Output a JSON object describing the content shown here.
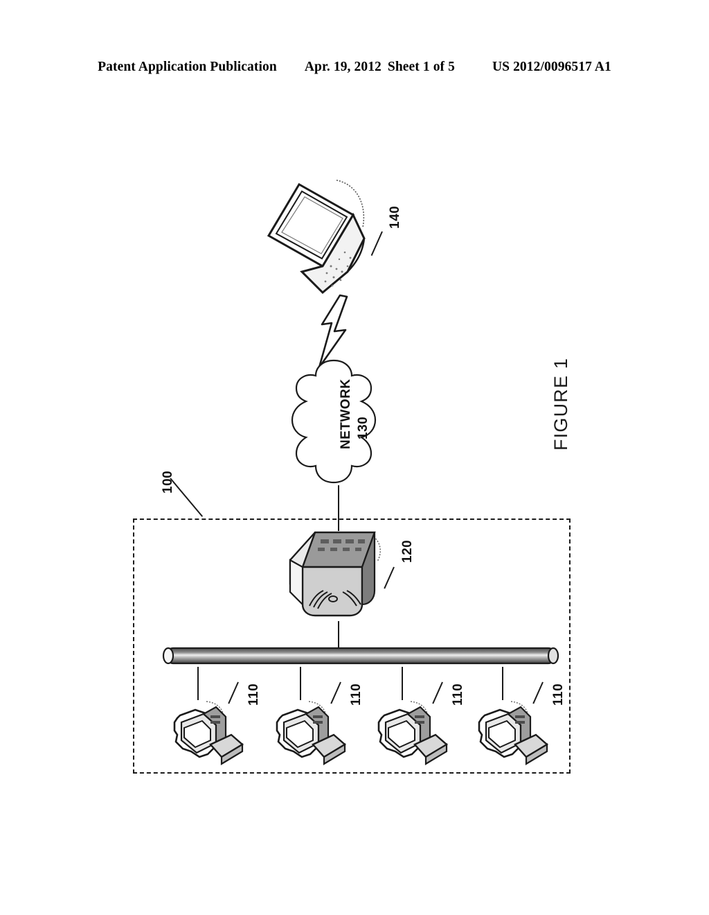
{
  "header": {
    "publication_label": "Patent Application Publication",
    "date": "Apr. 19, 2012",
    "sheet": "Sheet 1 of 5",
    "publication_number": "US 2012/0096517 A1"
  },
  "figure": {
    "caption": "FIGURE 1",
    "system_boundary_ref": "100",
    "cloud": {
      "label": "NETWORK",
      "ref": "130"
    },
    "mobile_device": {
      "name": "laptop-computer",
      "ref": "140"
    },
    "server": {
      "name": "server",
      "ref": "120"
    },
    "bus": {
      "name": "network-bus"
    },
    "terminals": [
      {
        "name": "workstation-1",
        "ref": "110"
      },
      {
        "name": "workstation-2",
        "ref": "110"
      },
      {
        "name": "workstation-3",
        "ref": "110"
      },
      {
        "name": "workstation-4",
        "ref": "110"
      }
    ],
    "wireless_link": {
      "name": "lightning-bolt",
      "symbol": "wireless-link-icon"
    }
  },
  "colors": {
    "ink": "#1b1b1b",
    "paper": "#ffffff",
    "shade_light": "#d9d9d9",
    "shade_mid": "#a8a8a8",
    "shade_dark": "#6e6e6e"
  }
}
